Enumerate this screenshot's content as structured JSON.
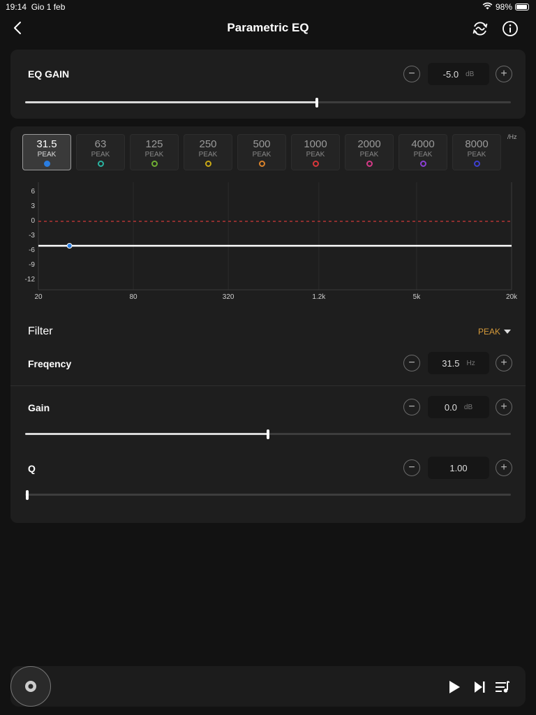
{
  "status": {
    "time": "19:14",
    "date": "Gio 1 feb",
    "battery": "98%"
  },
  "header": {
    "title": "Parametric EQ"
  },
  "eq_gain": {
    "label": "EQ GAIN",
    "value": "-5.0",
    "unit": "dB",
    "slider_level": 0.6
  },
  "bands": {
    "unit": "/Hz",
    "items": [
      {
        "freq": "31.5",
        "type": "PEAK",
        "color": "#2a7de1",
        "selected": true
      },
      {
        "freq": "63",
        "type": "PEAK",
        "color": "#2ab3a0",
        "selected": false
      },
      {
        "freq": "125",
        "type": "PEAK",
        "color": "#6fae33",
        "selected": false
      },
      {
        "freq": "250",
        "type": "PEAK",
        "color": "#c9a915",
        "selected": false
      },
      {
        "freq": "500",
        "type": "PEAK",
        "color": "#d9822b",
        "selected": false
      },
      {
        "freq": "1000",
        "type": "PEAK",
        "color": "#d9373b",
        "selected": false
      },
      {
        "freq": "2000",
        "type": "PEAK",
        "color": "#d43a87",
        "selected": false
      },
      {
        "freq": "4000",
        "type": "PEAK",
        "color": "#8b3fd4",
        "selected": false
      },
      {
        "freq": "8000",
        "type": "PEAK",
        "color": "#3e3fd0",
        "selected": false
      }
    ]
  },
  "graph": {
    "y_ticks": [
      "6",
      "3",
      "0",
      "-3",
      "-6",
      "-9",
      "-12"
    ],
    "x_ticks": [
      "20",
      "80",
      "320",
      "1.2k",
      "5k",
      "20k"
    ],
    "response_gain": -5.0,
    "point_freq": 31.5
  },
  "filter": {
    "label": "Filter",
    "value": "PEAK"
  },
  "frequency": {
    "label": "Freqency",
    "value": "31.5",
    "unit": "Hz"
  },
  "gain": {
    "label": "Gain",
    "value": "0.0",
    "unit": "dB",
    "slider_level": 0.5
  },
  "q": {
    "label": "Q",
    "value": "1.00",
    "slider_level": 0.0
  },
  "player": {
    "play": "play-icon",
    "next": "skip-next-icon",
    "queue": "playlist-icon"
  },
  "colors": {
    "accent_filter": "#d69a3a",
    "zero_line": "#d13a3a",
    "point": "#2a7de1"
  }
}
